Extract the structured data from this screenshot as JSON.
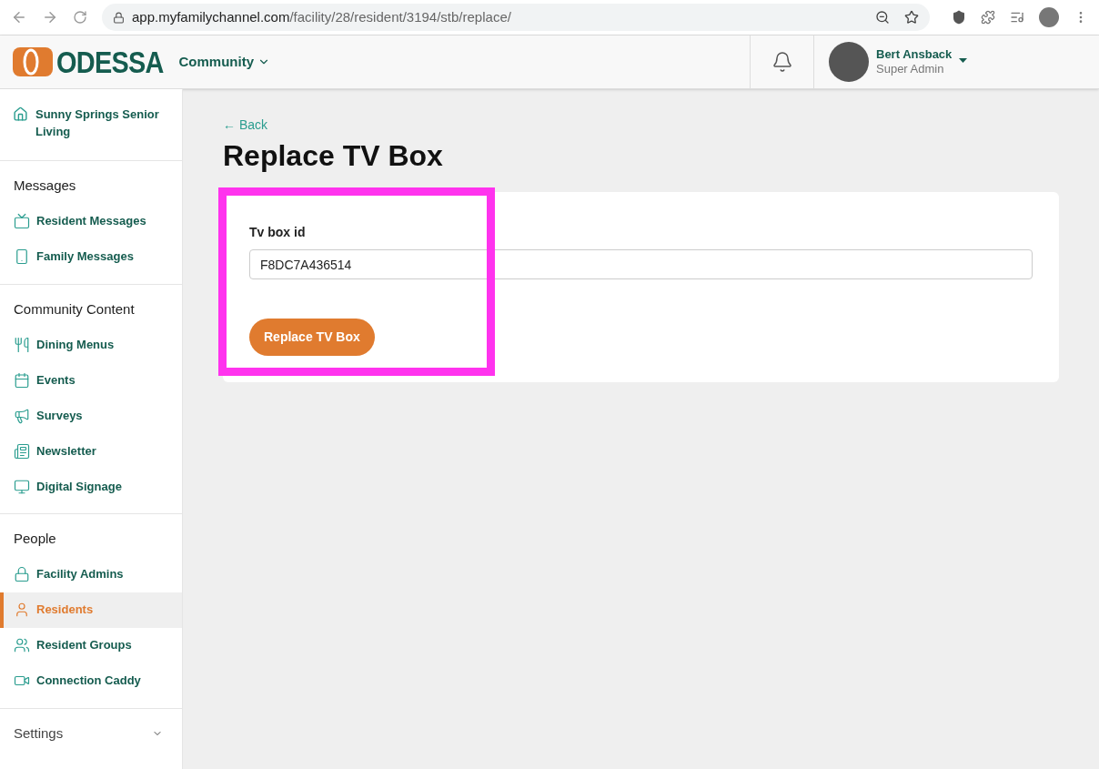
{
  "browser": {
    "url_host": "app.myfamilychannel.com",
    "url_path": "/facility/28/resident/3194/stb/replace/"
  },
  "header": {
    "logo": "ODESSA",
    "community": "Community",
    "user": {
      "name": "Bert Ansback",
      "role": "Super Admin"
    }
  },
  "sidebar": {
    "facility": "Sunny Springs Senior Living",
    "sections": [
      {
        "title": "Messages",
        "items": [
          {
            "label": "Resident Messages",
            "kind": "tv",
            "selected": false
          },
          {
            "label": "Family Messages",
            "kind": "phone",
            "selected": false
          }
        ]
      },
      {
        "title": "Community Content",
        "items": [
          {
            "label": "Dining Menus",
            "kind": "utensils",
            "selected": false
          },
          {
            "label": "Events",
            "kind": "calendar",
            "selected": false
          },
          {
            "label": "Surveys",
            "kind": "megaphone",
            "selected": false
          },
          {
            "label": "Newsletter",
            "kind": "newspaper",
            "selected": false
          },
          {
            "label": "Digital Signage",
            "kind": "monitor",
            "selected": false
          }
        ]
      },
      {
        "title": "People",
        "items": [
          {
            "label": "Facility Admins",
            "kind": "lock",
            "selected": false
          },
          {
            "label": "Residents",
            "kind": "user",
            "selected": true
          },
          {
            "label": "Resident Groups",
            "kind": "users",
            "selected": false
          },
          {
            "label": "Connection Caddy",
            "kind": "video",
            "selected": false
          }
        ]
      }
    ],
    "settings": "Settings"
  },
  "main": {
    "back": "← Back",
    "title": "Replace TV Box",
    "form": {
      "label": "Tv box id",
      "value": "F8DC7A436514",
      "button": "Replace TV Box"
    }
  }
}
